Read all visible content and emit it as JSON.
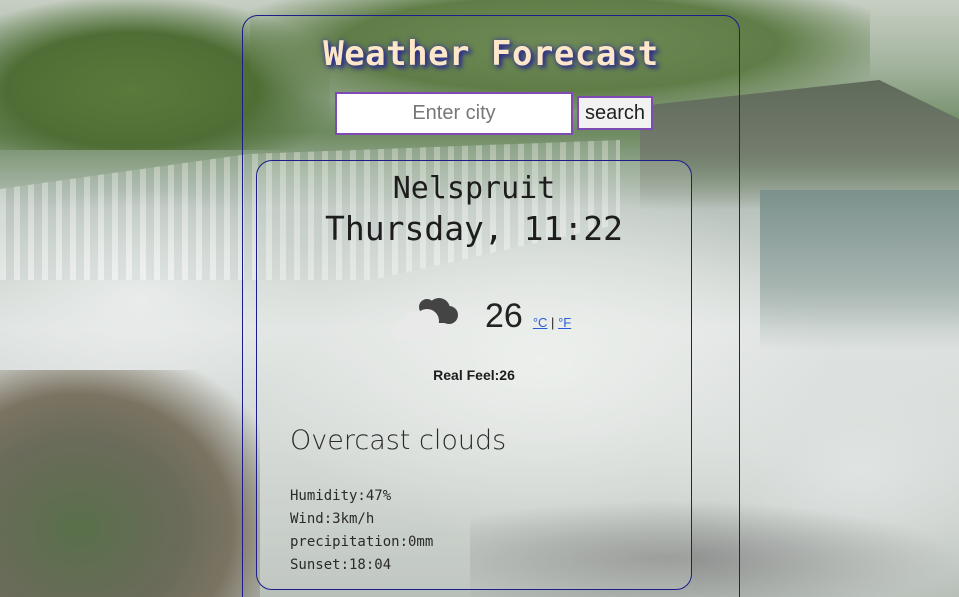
{
  "app": {
    "title": "Weather Forecast"
  },
  "search": {
    "placeholder": "Enter city",
    "value": "",
    "button_label": "search"
  },
  "current": {
    "city": "Nelspruit",
    "datetime": "Thursday, 11:22",
    "icon": "cloud-icon",
    "temperature": "26",
    "unit_celsius": "°C",
    "unit_separator": "|",
    "unit_fahrenheit": "°F",
    "real_feel": "Real Feel:26",
    "description": "Overcast clouds",
    "details": {
      "humidity": "Humidity:47%",
      "wind": "Wind:3km/h",
      "precipitation": "precipitation:0mm",
      "sunset": "Sunset:18:04"
    }
  },
  "colors": {
    "title": "#fde7c9",
    "title_shadow": "#2a2a8a",
    "frame_border": "#1c1c8a",
    "input_border": "#7d4bb3",
    "link": "#2a5bd7"
  }
}
